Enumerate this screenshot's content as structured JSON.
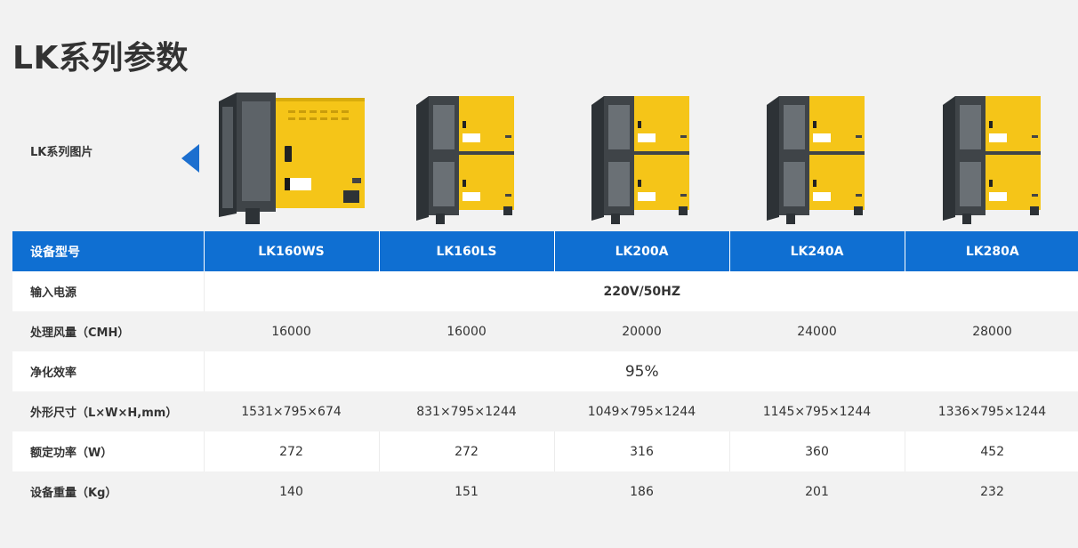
{
  "title": "LK系列参数",
  "images_label": "LK系列图片",
  "header": {
    "label": "设备型号",
    "models": [
      "LK160WS",
      "LK160LS",
      "LK200A",
      "LK240A",
      "LK280A"
    ]
  },
  "rows": {
    "power_input": {
      "label": "输入电源",
      "value": "220V/50HZ"
    },
    "air_volume": {
      "label": "处理风量（CMH）",
      "values": [
        "16000",
        "16000",
        "20000",
        "24000",
        "28000"
      ]
    },
    "efficiency": {
      "label": "净化效率",
      "value": "95%"
    },
    "dimensions": {
      "label": "外形尺寸（L×W×H,mm）",
      "values": [
        "1531×795×674",
        "831×795×1244",
        "1049×795×1244",
        "1145×795×1244",
        "1336×795×1244"
      ]
    },
    "rated_power": {
      "label": "额定功率（W）",
      "values": [
        "272",
        "272",
        "316",
        "360",
        "452"
      ]
    },
    "weight": {
      "label": "设备重量（Kg）",
      "values": [
        "140",
        "151",
        "186",
        "201",
        "232"
      ]
    }
  },
  "colors": {
    "header_blue": "#0f6fd2",
    "product_yellow": "#f5c518",
    "product_frame": "#3f4448"
  }
}
